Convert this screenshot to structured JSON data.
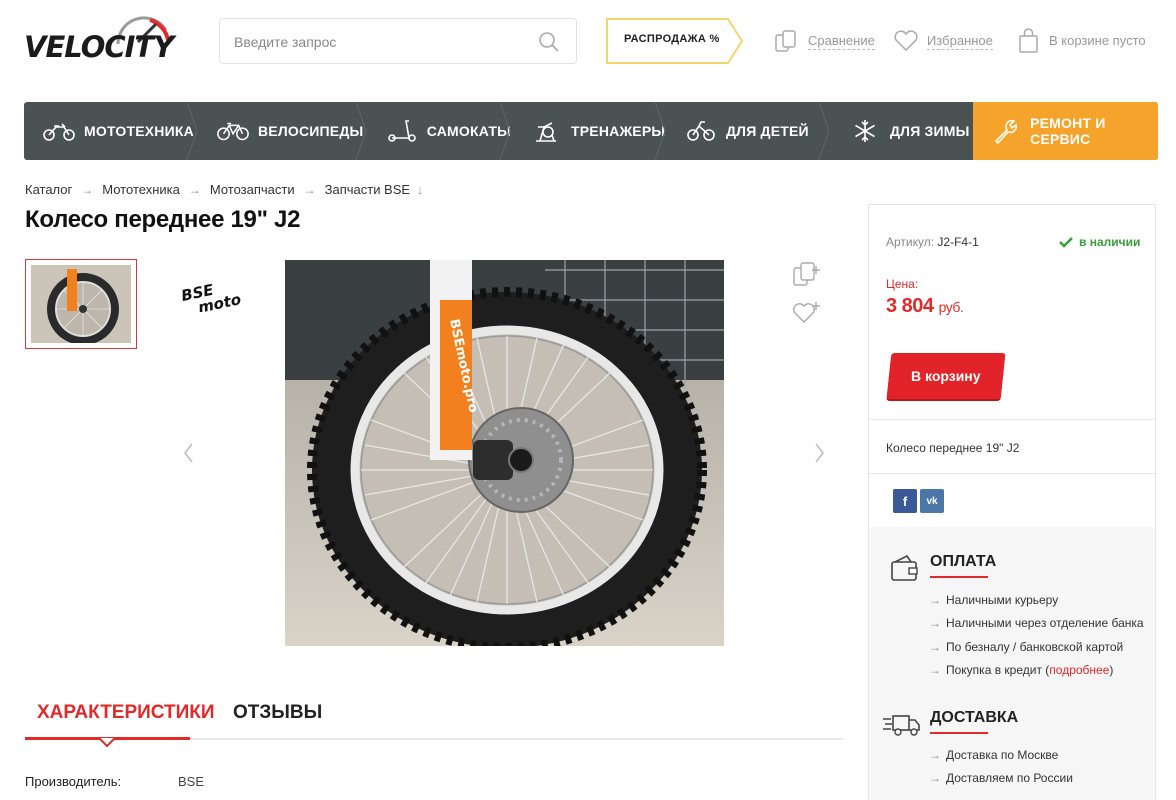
{
  "header": {
    "logo_text": "VELOCITY",
    "search_placeholder": "Введите запрос",
    "sale_label": "РАСПРОДАЖА %",
    "compare_label": "Сравнение",
    "favorites_label": "Избранное",
    "cart_label": "В корзине пусто"
  },
  "nav": {
    "items": [
      {
        "label": "МОТОТЕХНИКА",
        "icon": "motorcycle-icon"
      },
      {
        "label": "ВЕЛОСИПЕДЫ",
        "icon": "bicycle-icon"
      },
      {
        "label": "САМОКАТЫ",
        "icon": "scooter-icon"
      },
      {
        "label": "ТРЕНАЖЕРЫ",
        "icon": "exercise-bike-icon"
      },
      {
        "label": "ДЛЯ ДЕТЕЙ",
        "icon": "kids-bike-icon"
      },
      {
        "label": "ДЛЯ ЗИМЫ",
        "icon": "snowflake-icon"
      },
      {
        "label": "РЕМОНТ И СЕРВИС",
        "icon": "wrench-icon"
      }
    ],
    "accent_color": "#f6a32c",
    "bar_color": "#4a5254"
  },
  "breadcrumbs": [
    "Каталог",
    "Мототехника",
    "Мотозапчасти",
    "Запчасти BSE"
  ],
  "product": {
    "title": "Колесо переднее 19\" J2",
    "brand_logo": "BSE moto"
  },
  "tabs": {
    "active": "ХАРАКТЕРИСТИКИ",
    "second": "ОТЗЫВЫ"
  },
  "specs": [
    {
      "key": "Производитель:",
      "value": "BSE"
    }
  ],
  "sidebar": {
    "sku_label": "Артикул:",
    "sku_value": "J2-F4-1",
    "stock": "в наличии",
    "price_label": "Цена:",
    "price_value": "3 804",
    "price_currency": "руб.",
    "cart_button": "В корзину",
    "short_desc": "Колесо  переднее 19\" J2",
    "social": {
      "fb": "f",
      "vk": "vk"
    },
    "payment": {
      "title": "ОПЛАТА",
      "items": [
        "Наличными курьеру",
        "Наличными через отделение банка",
        "По безналу / банковской картой"
      ],
      "credit_prefix": "Покупка в кредит (",
      "credit_link": "подробнее",
      "credit_suffix": ")"
    },
    "delivery": {
      "title": "ДОСТАВКА",
      "items": [
        "Доставка по Москве",
        "Доставляем по России"
      ]
    }
  },
  "colors": {
    "red": "#e32a2a",
    "green": "#3a9c3a",
    "orange": "#f6a32c"
  }
}
